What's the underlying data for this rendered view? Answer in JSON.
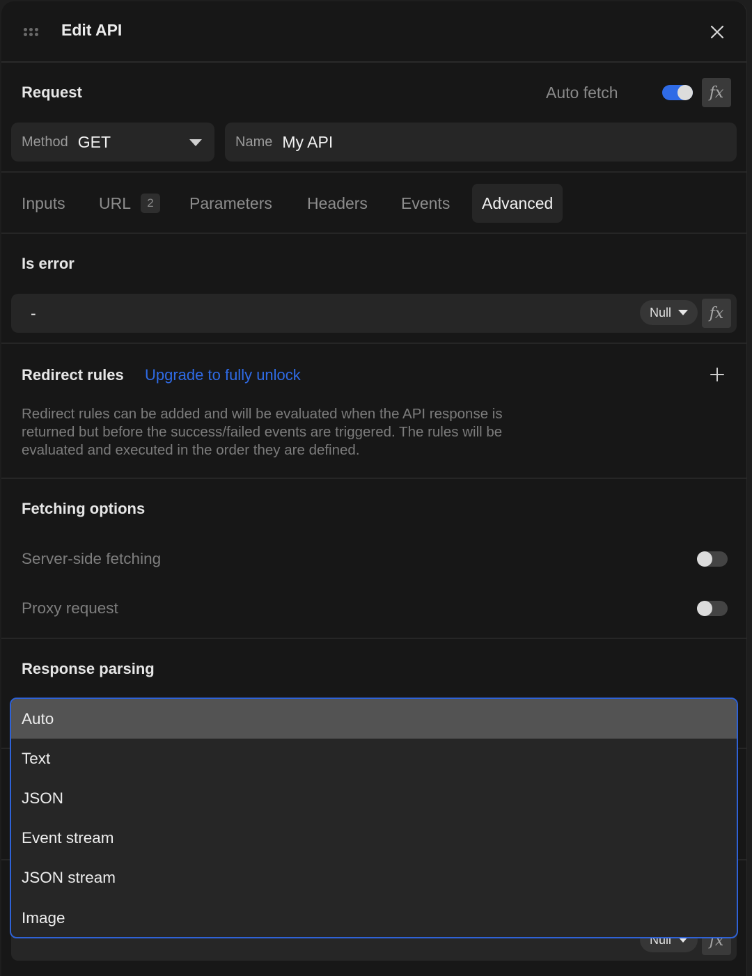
{
  "header": {
    "title": "Edit API"
  },
  "request": {
    "title": "Request",
    "auto_fetch_label": "Auto fetch",
    "auto_fetch_on": true,
    "fx_label": "fx",
    "method_label": "Method",
    "method_value": "GET",
    "name_label": "Name",
    "name_value": "My API"
  },
  "tabs": [
    {
      "label": "Inputs"
    },
    {
      "label": "URL",
      "badge": "2"
    },
    {
      "label": "Parameters"
    },
    {
      "label": "Headers"
    },
    {
      "label": "Events"
    },
    {
      "label": "Advanced",
      "active": true
    }
  ],
  "is_error": {
    "title": "Is error",
    "value": "-",
    "type_value": "Null",
    "fx_label": "fx"
  },
  "redirect_rules": {
    "title": "Redirect rules",
    "upgrade_link": "Upgrade to fully unlock",
    "description": "Redirect rules can be added and will be evaluated when the API response is returned but before the success/failed events are triggered. The rules will be evaluated and executed in the order they are defined."
  },
  "fetching_options": {
    "title": "Fetching options",
    "server_side_label": "Server-side fetching",
    "server_side_on": false,
    "proxy_label": "Proxy request",
    "proxy_on": false
  },
  "response_parsing": {
    "title": "Response parsing",
    "selected": "Auto",
    "options": [
      "Auto",
      "Text",
      "JSON",
      "Event stream",
      "JSON stream",
      "Image"
    ]
  },
  "hidden_field": {
    "value": "-",
    "type_value": "Null",
    "fx_label": "fx"
  },
  "colors": {
    "accent": "#2f6be6",
    "background": "#171717",
    "field": "#262626"
  }
}
